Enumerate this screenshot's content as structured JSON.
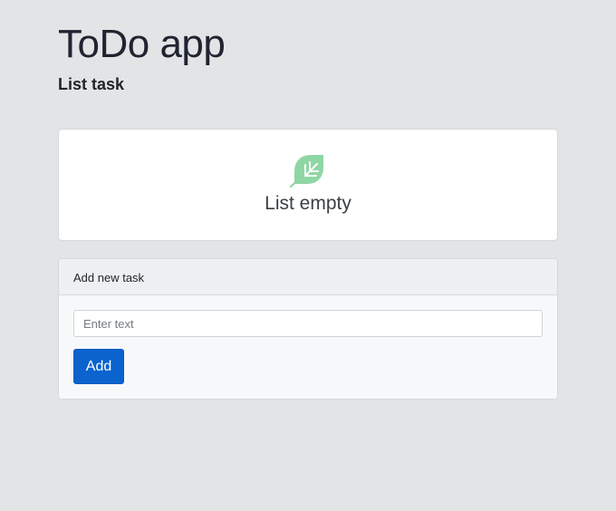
{
  "header": {
    "title": "ToDo app",
    "subtitle": "List task"
  },
  "task_list": {
    "empty_icon": "leaf-icon",
    "empty_message": "List empty",
    "items": []
  },
  "add_task": {
    "header": "Add new task",
    "input_value": "",
    "input_placeholder": "Enter text",
    "button_label": "Add"
  },
  "colors": {
    "background": "#e3e4e6",
    "accent": "#0b63ce",
    "leaf": "#8fd6a5"
  }
}
